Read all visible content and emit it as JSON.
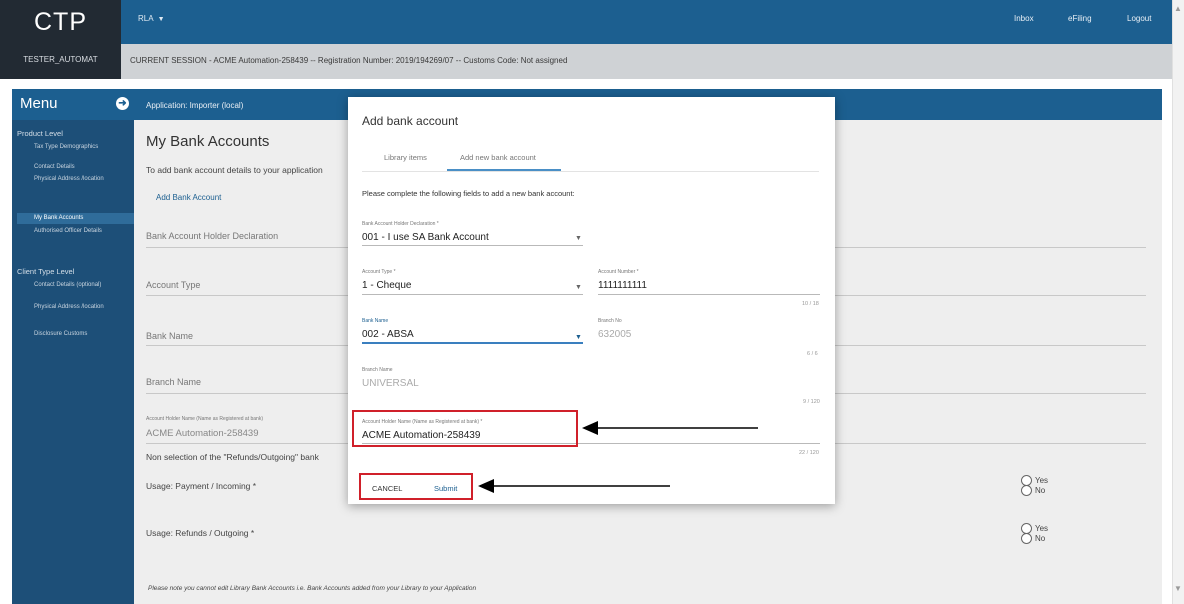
{
  "header": {
    "logo": "CTP",
    "user_id": "TESTER_AUTOMAT",
    "role_menu": "RLA",
    "links": [
      "Inbox",
      "eFiling",
      "Logout"
    ],
    "session": "CURRENT SESSION - ACME Automation-258439 -- Registration Number: 2019/194269/07 -- Customs Code: Not assigned"
  },
  "sidebar": {
    "title": "Menu",
    "sections": [
      {
        "label": "Product Level",
        "items": [
          {
            "label": "Tax Type Demographics",
            "active": false
          },
          {
            "label": "Contact Details",
            "active": false
          },
          {
            "label": "Physical Address /location",
            "active": false
          },
          {
            "label": "My Bank Accounts",
            "active": true
          },
          {
            "label": "Authorised Officer Details",
            "active": false
          }
        ]
      },
      {
        "label": "Client Type Level",
        "items": [
          {
            "label": "Contact Details (optional)",
            "active": false
          },
          {
            "label": "Physical Address /location",
            "active": false
          },
          {
            "label": "Disclosure Customs",
            "active": false
          }
        ]
      }
    ]
  },
  "main": {
    "application": "Application: Importer (local)",
    "title": "My Bank Accounts",
    "description": "To add bank account details to your application",
    "add_link": "Add Bank Account",
    "fields": [
      "Bank Account Holder Declaration",
      "Account Type",
      "Bank Name",
      "Branch Name"
    ],
    "holder_label": "Account Holder Name (Name as Registered at bank)",
    "holder_value": "ACME Automation-258439",
    "nonselection": "Non selection of the \"Refunds/Outgoing\" bank",
    "usage_payment": "Usage: Payment / Incoming *",
    "usage_refunds": "Usage: Refunds / Outgoing *",
    "yes": "Yes",
    "no": "No",
    "note": "Please note you cannot edit Library Bank Accounts i.e. Bank Accounts added from your Library to your Application"
  },
  "modal": {
    "title": "Add bank account",
    "tabs": [
      "Library items",
      "Add new bank account"
    ],
    "active_tab": "Add new bank account",
    "instruction": "Please complete the following fields to add a new bank account:",
    "declaration_label": "Bank Account Holder Declaration *",
    "declaration_value": "001 - I use SA Bank Account",
    "account_type_label": "Account Type *",
    "account_type_value": "1 - Cheque",
    "account_number_label": "Account Number *",
    "account_number_value": "1111111111",
    "account_number_counter": "10 / 18",
    "bank_name_label": "Bank Name",
    "bank_name_value": "002 - ABSA",
    "branch_no_label": "Branch No",
    "branch_no_value": "632005",
    "branch_no_counter": "6 / 6",
    "branch_name_label": "Branch Name",
    "branch_name_value": "UNIVERSAL",
    "branch_name_counter": "9 / 120",
    "holder_label": "Account Holder Name (Name as Registered at bank) *",
    "holder_value": "ACME Automation-258439",
    "holder_counter": "22 / 120",
    "cancel_label": "CANCEL",
    "submit_label": "Submit"
  },
  "colors": {
    "primary": "#1c5f90",
    "sidebar": "#1d4f78",
    "dark_logo": "#222a33",
    "highlight": "#d0202a"
  }
}
